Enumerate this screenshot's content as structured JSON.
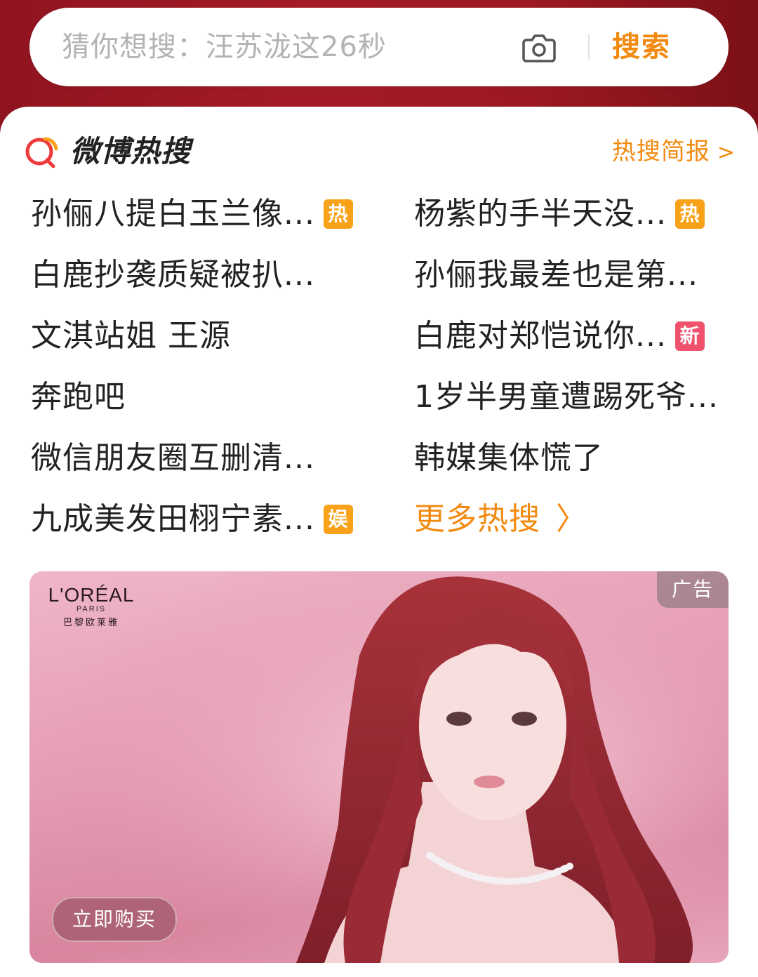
{
  "search": {
    "placeholder": "猜你想搜：汪苏泷这26秒",
    "button_label": "搜索"
  },
  "hot": {
    "title": "微博热搜",
    "brief_label": "热搜简报",
    "brief_chevron": ">",
    "left": [
      {
        "text": "孙俪八提白玉兰像...",
        "badge": "热"
      },
      {
        "text": "白鹿抄袭质疑被扒...",
        "badge": ""
      },
      {
        "text": "文淇站姐 王源",
        "badge": ""
      },
      {
        "text": "奔跑吧",
        "badge": ""
      },
      {
        "text": "微信朋友圈互删清...",
        "badge": ""
      },
      {
        "text": "九成美发田栩宁素...",
        "badge": "娱"
      }
    ],
    "right": [
      {
        "text": "杨紫的手半天没...",
        "badge": "热"
      },
      {
        "text": "孙俪我最差也是第...",
        "badge": ""
      },
      {
        "text": "白鹿对郑恺说你...",
        "badge": "新"
      },
      {
        "text": "1岁半男童遭踢死爷...",
        "badge": ""
      },
      {
        "text": "韩媒集体慌了",
        "badge": ""
      }
    ],
    "more_label": "更多热搜",
    "more_chevron": "〉"
  },
  "ad": {
    "brand": "L'ORÉAL",
    "brand_sub": "PARIS",
    "brand_cn": "巴黎欧莱雅",
    "tag": "广告",
    "cta": "立即购买"
  },
  "colors": {
    "accent": "#f28a10",
    "header_red": "#9c1921",
    "badge_hot": "#f8a21a",
    "badge_new": "#f0526d"
  }
}
